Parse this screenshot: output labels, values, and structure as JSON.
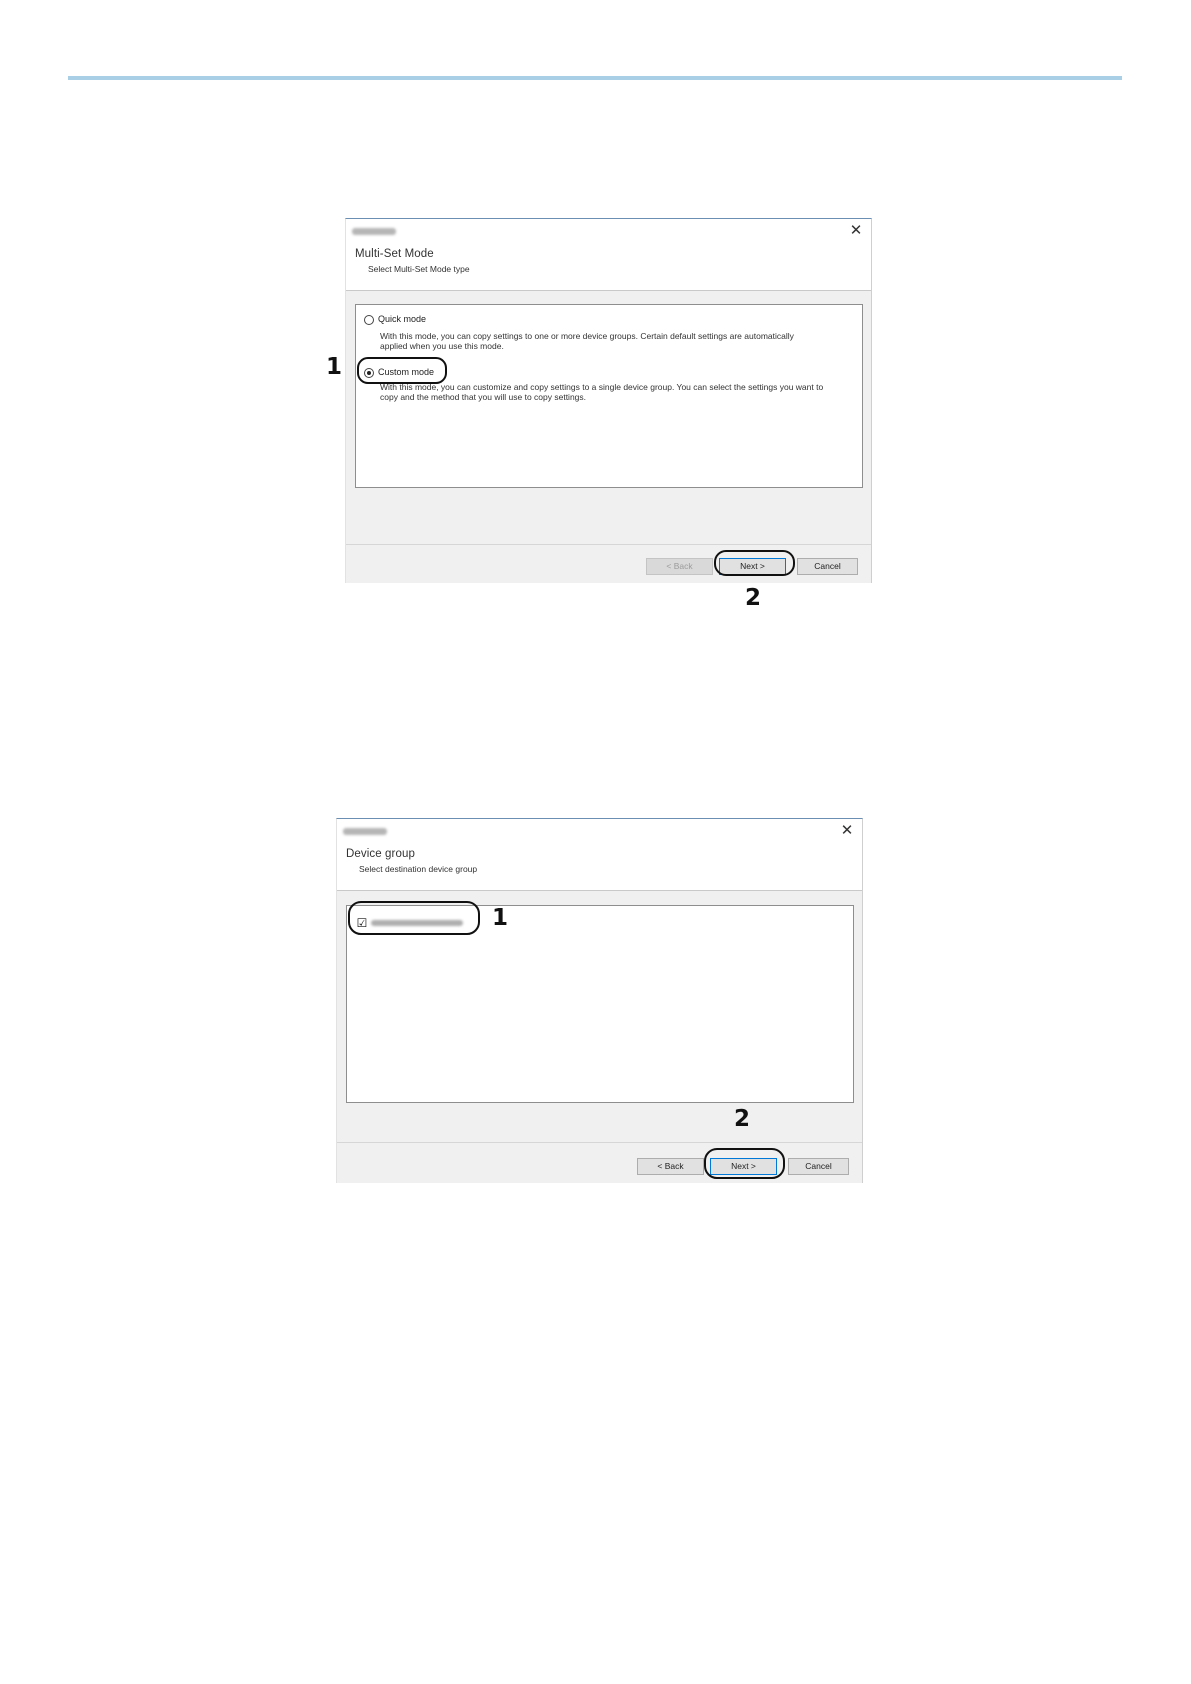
{
  "dialog1": {
    "close_glyph": "✕",
    "header_title": "Multi-Set Mode",
    "header_subtitle": "Select Multi-Set Mode type",
    "quick_mode": {
      "label": "Quick mode",
      "description": "With this mode, you can copy settings to one or more device groups. Certain default settings are automatically applied when you use this mode.",
      "selected": false
    },
    "custom_mode": {
      "label": "Custom mode",
      "description": "With this mode, you can customize and copy settings to a single device group. You can select the settings you want to copy and the method that you will use to copy settings.",
      "selected": true
    },
    "buttons": {
      "back": "< Back",
      "next": "Next >",
      "cancel": "Cancel"
    },
    "callouts": {
      "first": "1",
      "second": "2"
    }
  },
  "dialog2": {
    "close_glyph": "✕",
    "header_title": "Device group",
    "header_subtitle": "Select destination device group",
    "group_checkbox": {
      "checked": true,
      "glyph": "☑"
    },
    "buttons": {
      "back": "< Back",
      "next": "Next >",
      "cancel": "Cancel"
    },
    "callouts": {
      "first": "1",
      "second": "2"
    }
  },
  "colors": {
    "accent_rule": "#a9cfe6",
    "dialog_bg": "#f0f0f0",
    "focus_border": "#0078d7"
  }
}
